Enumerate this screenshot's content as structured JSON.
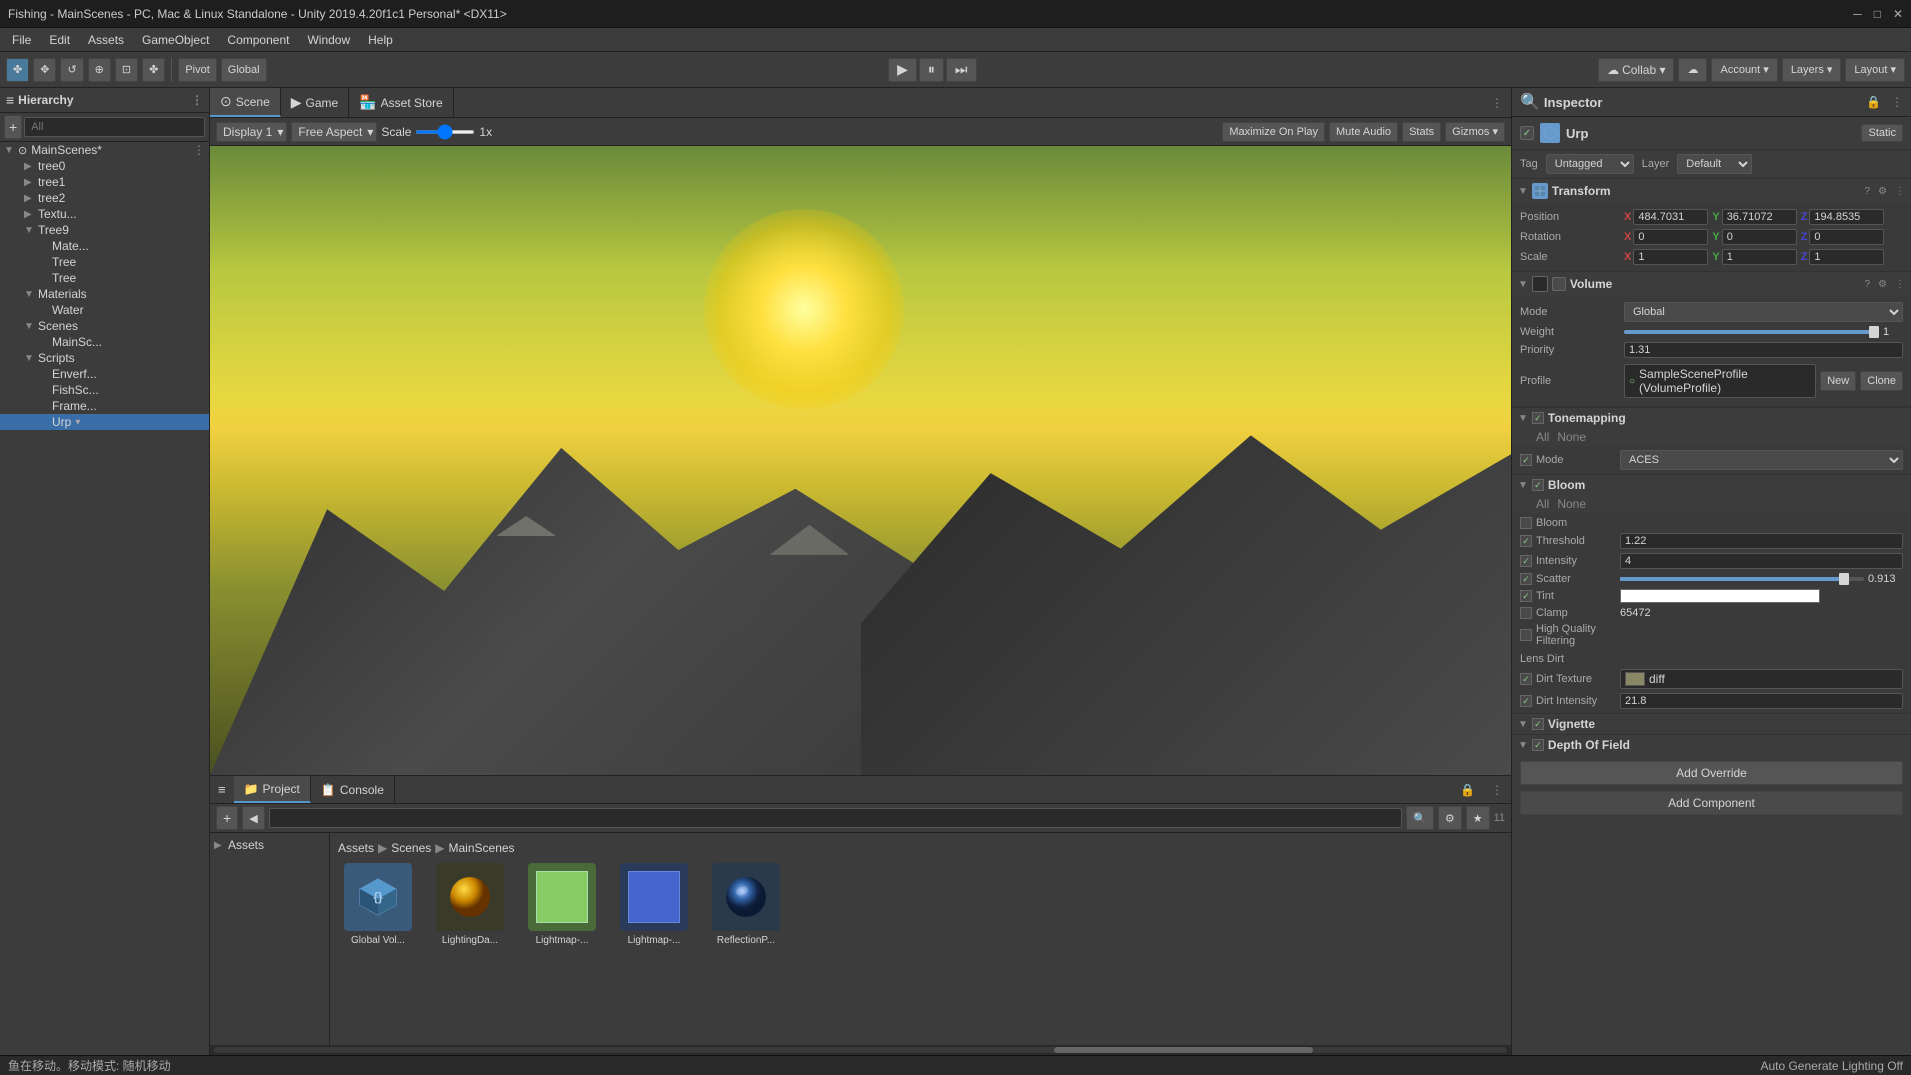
{
  "titlebar": {
    "title": "Fishing - MainScenes - PC, Mac & Linux Standalone - Unity 2019.4.20f1c1 Personal* <DX11>",
    "controls": {
      "min": "─",
      "max": "□",
      "close": "✕"
    }
  },
  "menubar": {
    "items": [
      "File",
      "Edit",
      "Assets",
      "GameObject",
      "Component",
      "Window",
      "Help"
    ]
  },
  "toolbar": {
    "transform_tools": [
      "✤",
      "✥",
      "↺",
      "⊕",
      "⊡"
    ],
    "pivot_label": "Pivot",
    "global_label": "Global",
    "collab_label": "Collab ▾",
    "account_label": "Account ▾",
    "layers_label": "Layers ▾",
    "layout_label": "Layout ▾"
  },
  "hierarchy": {
    "title": "Hierarchy",
    "search_placeholder": "All",
    "items": [
      {
        "label": "MainScenes*",
        "depth": 0,
        "has_children": true,
        "is_root": true
      }
    ],
    "sub_items": [
      {
        "label": "tree0",
        "depth": 1
      },
      {
        "label": "tree1",
        "depth": 1
      },
      {
        "label": "tree2",
        "depth": 1
      },
      {
        "label": "Textu...",
        "depth": 1
      },
      {
        "label": "Tree9",
        "depth": 1
      },
      {
        "label": "Mate...",
        "depth": 2
      },
      {
        "label": "Tree",
        "depth": 2
      },
      {
        "label": "Tree",
        "depth": 2
      },
      {
        "label": "Materials",
        "depth": 1,
        "collapsed": false
      },
      {
        "label": "Water",
        "depth": 2
      },
      {
        "label": "Scenes",
        "depth": 1,
        "collapsed": false
      },
      {
        "label": "MainSc...",
        "depth": 2
      },
      {
        "label": "Scripts",
        "depth": 1,
        "collapsed": false
      },
      {
        "label": "Enverf...",
        "depth": 2
      },
      {
        "label": "FishSc...",
        "depth": 2
      },
      {
        "label": "Frame...",
        "depth": 2
      },
      {
        "label": "Urp",
        "depth": 2
      }
    ]
  },
  "scene_tabs": [
    {
      "label": "Scene",
      "icon": "⊙",
      "active": true
    },
    {
      "label": "Game",
      "icon": "▶",
      "active": false
    },
    {
      "label": "Asset Store",
      "icon": "🏪",
      "active": false
    }
  ],
  "scene_toolbar": {
    "display": "Display 1",
    "aspect": "Free Aspect",
    "scale_label": "Scale",
    "scale_value": "1x",
    "maximize": "Maximize On Play",
    "mute_audio": "Mute Audio",
    "stats": "Stats",
    "gizmos": "Gizmos ▾"
  },
  "bottom_tabs": [
    {
      "label": "Project",
      "icon": "📁",
      "active": true
    },
    {
      "label": "Console",
      "icon": "📋",
      "active": false
    }
  ],
  "project": {
    "search_placeholder": "",
    "breadcrumb": [
      "Assets",
      "Scenes",
      "MainScenes"
    ],
    "asset_count": "11",
    "assets": [
      {
        "label": "Global Vol...",
        "icon_type": "cube",
        "color": "#5599cc"
      },
      {
        "label": "LightingDa...",
        "icon_type": "sphere",
        "color": "#cc9900"
      },
      {
        "label": "Lightmap-...",
        "icon_type": "square",
        "color": "#88cc66"
      },
      {
        "label": "Lightmap-...",
        "icon_type": "square",
        "color": "#4466cc"
      },
      {
        "label": "ReflectionP...",
        "icon_type": "sphere",
        "color": "#3366aa"
      }
    ]
  },
  "inspector": {
    "title": "Inspector",
    "object": {
      "name": "Urp",
      "enabled": true,
      "tag": "Untagged",
      "layer": "Default",
      "static": "Static"
    },
    "transform": {
      "label": "Transform",
      "position": {
        "x": "484.7031",
        "y": "36.71072",
        "z": "194.8535"
      },
      "rotation": {
        "x": "0",
        "y": "0",
        "z": "0"
      },
      "scale": {
        "x": "1",
        "y": "1",
        "z": "1"
      }
    },
    "volume": {
      "label": "Volume",
      "mode": "Global",
      "weight": "1",
      "priority": "1.31",
      "profile": "SampleSceneProfile (VolumeProfile)",
      "profile_icon": "○"
    },
    "tonemapping": {
      "label": "Tonemapping",
      "enabled": true,
      "all": "All",
      "none": "None",
      "mode_label": "Mode",
      "mode_value": "ACES"
    },
    "bloom": {
      "label": "Bloom",
      "enabled": true,
      "all": "All",
      "none": "None",
      "bloom_label": "Bloom",
      "threshold": {
        "label": "Threshold",
        "value": "1.22"
      },
      "intensity": {
        "label": "Intensity",
        "value": "4"
      },
      "scatter": {
        "label": "Scatter",
        "value": "0.913",
        "fill_pct": 92
      },
      "tint": {
        "label": "Tint",
        "value": ""
      },
      "clamp": {
        "label": "Clamp",
        "value": ""
      },
      "clamp_number": "65472",
      "high_quality": {
        "label": "High Quality Filtering",
        "value": ""
      },
      "lens_dirt_label": "Lens Dirt",
      "dirt_texture": {
        "label": "Dirt Texture",
        "value": "diff"
      },
      "dirt_intensity": {
        "label": "Dirt Intensity",
        "value": "21.8"
      }
    },
    "vignette": {
      "label": "Vignette",
      "enabled": true
    },
    "depth_of_field": {
      "label": "Depth Of Field",
      "enabled": true
    },
    "add_override": "Add Override",
    "add_component": "Add Component"
  },
  "status": {
    "left": "鱼在移动。移动模式: 随机移动",
    "right": "Auto Generate Lighting Off"
  }
}
